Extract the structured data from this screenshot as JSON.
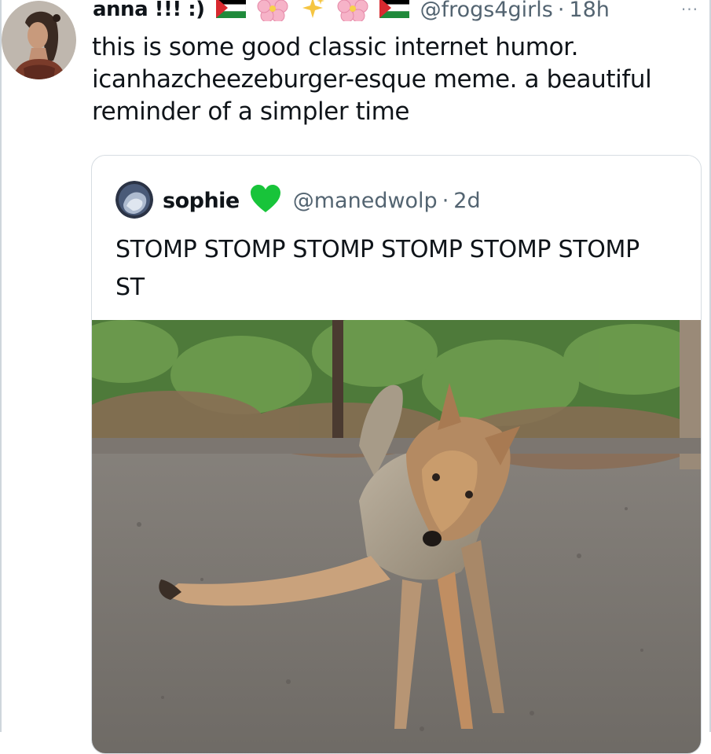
{
  "tweet": {
    "display_name": "anna !!! :)",
    "handle": "@frogs4girls",
    "separator": "·",
    "time": "18h",
    "more": "···",
    "text": "this is some good classic internet humor. icanhazcheezeburger-esque meme. a beautiful reminder of a simpler time",
    "badge_icons": [
      "palestine-flag-icon",
      "flower-icon",
      "sparkles-icon",
      "flower-icon",
      "palestine-flag-icon"
    ]
  },
  "quote": {
    "display_name": "sophie",
    "badge_icon": "green-heart-icon",
    "handle": "@manedwolp",
    "separator": "·",
    "time": "2d",
    "text": "STOMP STOMP STOMP STOMP STOMP STOMP ST"
  },
  "colors": {
    "text": "#0f1419",
    "secondary": "#536471",
    "border": "#d7dde2",
    "heart": "#18c43a",
    "flag_red": "#d8292f",
    "flag_green": "#1f8a3a"
  }
}
